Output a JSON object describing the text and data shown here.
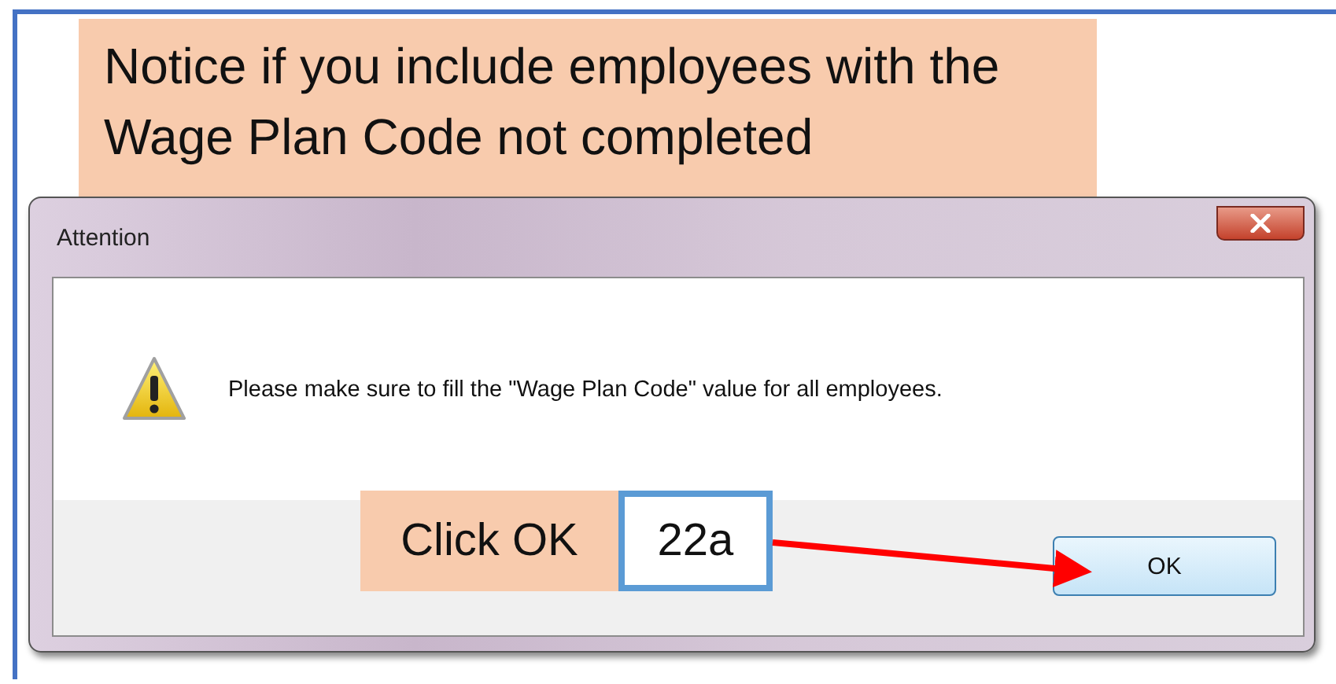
{
  "callout": {
    "text": "Notice if you include employees with the Wage Plan Code not completed"
  },
  "dialog": {
    "title": "Attention",
    "message": "Please make sure to fill the \"Wage Plan Code\" value for all employees.",
    "buttons": [
      "OK"
    ]
  },
  "annotation": {
    "label": "Click OK",
    "step": "22a"
  }
}
